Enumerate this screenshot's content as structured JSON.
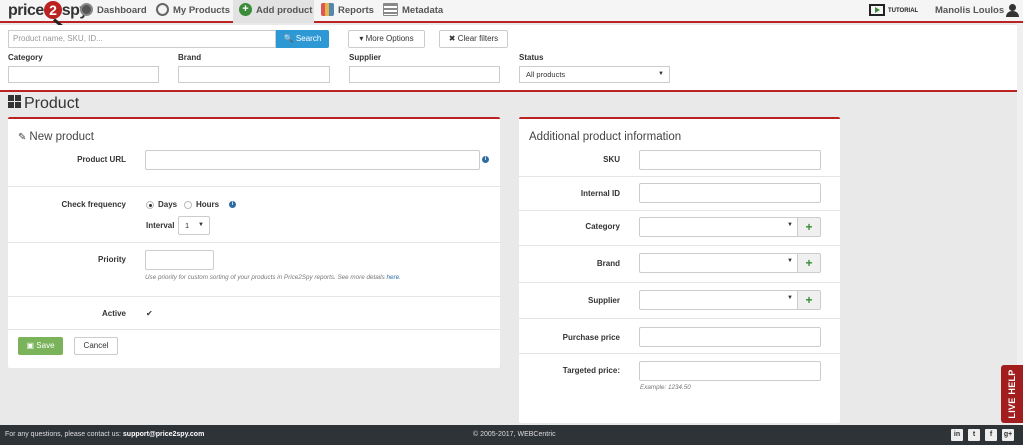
{
  "nav": {
    "logo_pre": "price",
    "logo_mid": "2",
    "logo_post": "spy",
    "items": [
      {
        "label": "Dashboard",
        "icon": "dashboard-icon"
      },
      {
        "label": "My Products",
        "icon": "search-icon"
      },
      {
        "label": "Add product",
        "icon": "add-icon",
        "active": true
      },
      {
        "label": "Reports",
        "icon": "reports-icon"
      },
      {
        "label": "Metadata",
        "icon": "metadata-icon"
      }
    ],
    "tutorial": "TUTORIAL",
    "user": "Manolis Loulos"
  },
  "filters": {
    "search_placeholder": "Product name, SKU, ID...",
    "search_btn": "🔍 Search",
    "more_options": "▾ More Options",
    "clear_filters": "✖ Clear filters",
    "category_label": "Category",
    "brand_label": "Brand",
    "supplier_label": "Supplier",
    "status_label": "Status",
    "status_value": "All products"
  },
  "page": {
    "title": "Product"
  },
  "new_product": {
    "heading": "New product",
    "product_url_label": "Product URL",
    "check_frequency_label": "Check frequency",
    "days_label": "Days",
    "hours_label": "Hours",
    "interval_label": "Interval",
    "interval_value": "1",
    "priority_label": "Priority",
    "priority_help_pre": "Use priority for custom sorting of your products in Price2Spy reports. See more details ",
    "priority_help_link": "here",
    "priority_help_post": ".",
    "active_label": "Active",
    "save_label": "Save",
    "cancel_label": "Cancel"
  },
  "additional": {
    "heading": "Additional product information",
    "sku_label": "SKU",
    "internal_id_label": "Internal ID",
    "category_label": "Category",
    "brand_label": "Brand",
    "supplier_label": "Supplier",
    "purchase_price_label": "Purchase price",
    "targeted_price_label": "Targeted price:",
    "example": "Example: 1234.50"
  },
  "footer": {
    "contact_pre": "For any questions, please contact us: ",
    "contact_email": "support@price2spy.com",
    "copyright": "© 2005-2017, WEBCentric",
    "social": [
      "in",
      "t",
      "f",
      "g+"
    ]
  },
  "live_help": "LIVE HELP",
  "colors": {
    "accent": "#b22222",
    "search_blue": "#2e98d4",
    "save_green": "#7ab35a",
    "footer": "#2e3338"
  }
}
